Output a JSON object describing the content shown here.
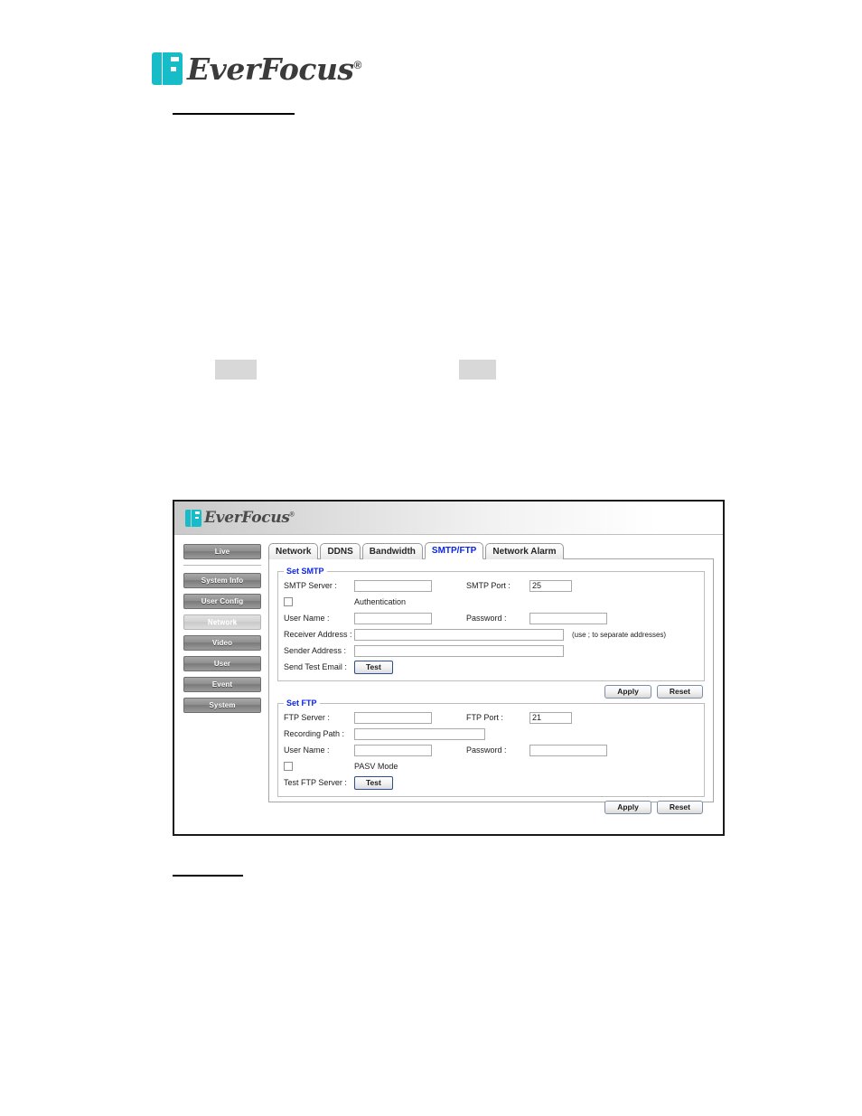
{
  "document": {
    "brand_name": "EverFocus",
    "brand_reg": "®"
  },
  "screenshot": {
    "app_brand": "EverFocus",
    "app_brand_reg": "®",
    "sidebar": {
      "primary": [
        {
          "label": "Live",
          "active": false
        }
      ],
      "items": [
        {
          "label": "System Info",
          "active": false
        },
        {
          "label": "User Config",
          "active": false
        },
        {
          "label": "Network",
          "active": true
        },
        {
          "label": "Video",
          "active": false
        },
        {
          "label": "User",
          "active": false
        },
        {
          "label": "Event",
          "active": false
        },
        {
          "label": "System",
          "active": false
        }
      ]
    },
    "tabs": [
      {
        "label": "Network",
        "active": false
      },
      {
        "label": "DDNS",
        "active": false
      },
      {
        "label": "Bandwidth",
        "active": false
      },
      {
        "label": "SMTP/FTP",
        "active": true
      },
      {
        "label": "Network Alarm",
        "active": false
      }
    ],
    "smtp": {
      "legend": "Set SMTP",
      "server_label": "SMTP Server :",
      "server_value": "",
      "port_label": "SMTP Port :",
      "port_value": "25",
      "auth_label": "Authentication",
      "auth_checked": false,
      "user_label": "User Name :",
      "user_value": "",
      "password_label": "Password :",
      "password_value": "",
      "receiver_label": "Receiver Address :",
      "receiver_value": "",
      "receiver_note": "(use ; to separate addresses)",
      "sender_label": "Sender Address :",
      "sender_value": "",
      "test_email_label": "Send Test Email :",
      "test_button": "Test",
      "apply_button": "Apply",
      "reset_button": "Reset"
    },
    "ftp": {
      "legend": "Set FTP",
      "server_label": "FTP Server :",
      "server_value": "",
      "port_label": "FTP Port :",
      "port_value": "21",
      "path_label": "Recording Path :",
      "path_value": "",
      "user_label": "User Name :",
      "user_value": "",
      "password_label": "Password :",
      "password_value": "",
      "pasv_label": "PASV Mode",
      "pasv_checked": false,
      "test_server_label": "Test FTP Server :",
      "test_button": "Test",
      "apply_button": "Apply",
      "reset_button": "Reset"
    }
  },
  "colors": {
    "brand_cyan": "#16bdc8",
    "accent_blue": "#0a24e8",
    "redaction_gray": "#d8d8d8"
  }
}
